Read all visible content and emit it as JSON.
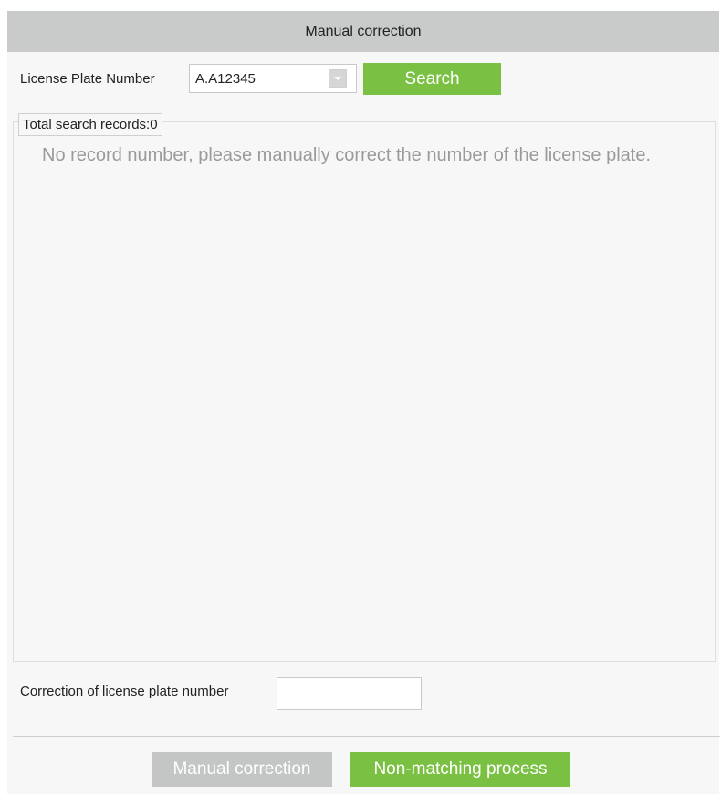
{
  "dialog": {
    "title": "Manual correction"
  },
  "search": {
    "label": "License Plate Number",
    "value": "A.A12345",
    "button_label": "Search"
  },
  "results": {
    "total_label": "Total search records:0",
    "empty_message": "No record number, please manually correct the number of the license plate."
  },
  "correction": {
    "label": "Correction of license plate number",
    "value": ""
  },
  "footer": {
    "manual_correction_label": "Manual correction",
    "non_matching_label": "Non-matching process"
  },
  "colors": {
    "accent_green": "#7ac143",
    "disabled_gray": "#c4c6c6",
    "titlebar_gray": "#c9cbcb"
  },
  "icons": {
    "combo_arrow": "chevron-down-icon"
  }
}
